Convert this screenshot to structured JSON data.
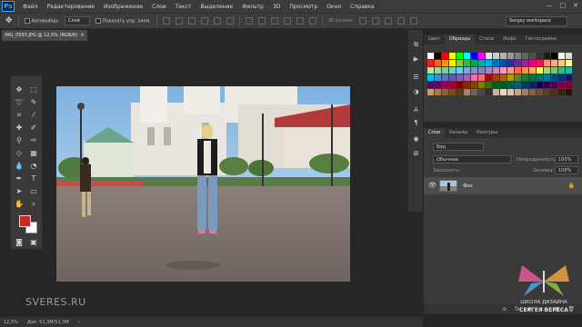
{
  "menubar": {
    "logo": "Ps",
    "items": [
      "Файл",
      "Редактирование",
      "Изображение",
      "Слои",
      "Текст",
      "Выделение",
      "Фильтр",
      "3D",
      "Просмотр",
      "Окно",
      "Справка"
    ],
    "controls": [
      "—",
      "□",
      "✕"
    ]
  },
  "options": {
    "autoselect_label": "Автовыбор:",
    "autoselect_value": "Слой",
    "show_controls_label": "Показать упр. элем.",
    "mode_3d_label": "3D-режим:",
    "workspace": "Sergey workspace"
  },
  "document": {
    "tab_title": "IMG_0593.JPG @ 12,5% (RGB/8)",
    "close": "×"
  },
  "status": {
    "zoom": "12,5%",
    "doc_size": "Док: 51,3M/51,3M",
    "arrow": "›"
  },
  "watermark": {
    "text": "SVERES.RU"
  },
  "swatches_panel": {
    "tabs": [
      "Цвет",
      "Образцы",
      "Стили",
      "Инфо",
      "Гистограмма"
    ],
    "active_tab": "Образцы",
    "colors": [
      "#ffffff",
      "#000000",
      "#ff0000",
      "#ffff00",
      "#00ff00",
      "#00ffff",
      "#0000ff",
      "#ff00ff",
      "#e6e6e6",
      "#cccccc",
      "#b3b3b3",
      "#999999",
      "#808080",
      "#666666",
      "#4d4d4d",
      "#333333",
      "#1a1a1a",
      "#000000",
      "#f2f2f2",
      "#dcdcdc",
      "#ee1d24",
      "#f26522",
      "#f7941d",
      "#fff200",
      "#8dc63f",
      "#39b54a",
      "#00a651",
      "#00a99d",
      "#00aeef",
      "#0072bc",
      "#0054a6",
      "#2e3192",
      "#662d91",
      "#92278f",
      "#ec008c",
      "#ed145b",
      "#f7977a",
      "#f9ad81",
      "#fdc68a",
      "#fff79a",
      "#c4df9b",
      "#a3d39c",
      "#82ca9c",
      "#7accc8",
      "#6dcff6",
      "#7da7d9",
      "#8393ca",
      "#8781bd",
      "#a187be",
      "#bd8cbf",
      "#f49ac2",
      "#f6989d",
      "#f26c4f",
      "#f68e56",
      "#fbaf5c",
      "#fff467",
      "#acd372",
      "#7cc576",
      "#3bb878",
      "#1abbb4",
      "#00bff3",
      "#438ccb",
      "#5574b9",
      "#605ca8",
      "#855fa8",
      "#a763a8",
      "#f06eaa",
      "#f26d7d",
      "#9e0b0f",
      "#a0410d",
      "#a36209",
      "#aba000",
      "#598527",
      "#197b30",
      "#007236",
      "#00746b",
      "#0076a3",
      "#004a80",
      "#003471",
      "#1b1464",
      "#440e62",
      "#630460",
      "#9e005d",
      "#9e0039",
      "#790000",
      "#7b2e00",
      "#7d4900",
      "#827b00",
      "#406618",
      "#005e20",
      "#005826",
      "#005952",
      "#005b7f",
      "#003663",
      "#002157",
      "#0d004c",
      "#32004b",
      "#4b0049",
      "#7b0046",
      "#7a0026",
      "#c69c6d",
      "#a67c52",
      "#8c6239",
      "#754c24",
      "#603913",
      "#998675",
      "#736357",
      "#534741",
      "#362f2d",
      "#c7b299",
      "#e6d5c1",
      "#d9c6ae",
      "#bfa58a",
      "#9c8165",
      "#7f6449",
      "#6b5138",
      "#5a3f2a",
      "#47301e",
      "#362212",
      "#251507"
    ]
  },
  "layers_panel": {
    "tabs": [
      "Слои",
      "Каналы",
      "Контуры"
    ],
    "active_tab": "Слои",
    "filter_placeholder": "Вид",
    "blend_mode": "Обычные",
    "opacity_label": "Непрозрачность:",
    "opacity_value": "100%",
    "lock_label": "Закрепить:",
    "fill_label": "Заливка:",
    "fill_value": "100%",
    "layer_name": "Фон",
    "bottom_icons": [
      "⊝",
      "fx",
      "◐",
      "▭",
      "▤",
      "🗑"
    ]
  },
  "school": {
    "line1": "ШКОЛА ДИЗАЙНА",
    "line2": "СЕРГЕЯ ВЕРЕСА"
  }
}
